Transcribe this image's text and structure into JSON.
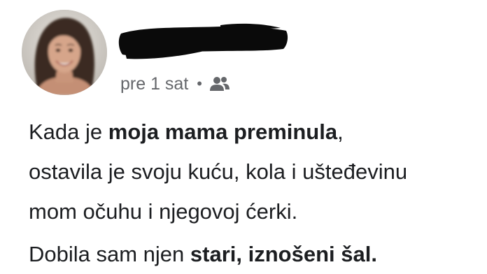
{
  "post": {
    "timestamp": "pre 1 sat",
    "separator": "•",
    "audience_icon": "friends-icon",
    "author_name_redacted": true,
    "paragraph1": {
      "line1_pre": "Kada je ",
      "line1_bold": "moja mama preminula",
      "line1_post": ",",
      "line2": "ostavila je svoju kuću, kola i ušteđevinu",
      "line3": "mom očuhu i njegovoj ćerki."
    },
    "paragraph2": {
      "pre": "Dobila sam njen ",
      "bold": "stari, iznošeni šal."
    }
  },
  "colors": {
    "text": "#1c1e21",
    "meta": "#65676b",
    "redaction": "#0a0a0a"
  }
}
